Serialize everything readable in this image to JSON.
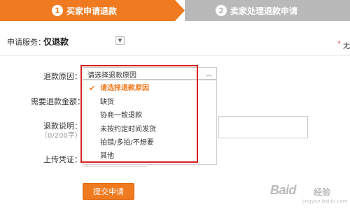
{
  "steps": [
    {
      "number": "1",
      "label": "买家申请退款",
      "active": true
    },
    {
      "number": "2",
      "label": "卖家处理退款申请",
      "active": false
    }
  ],
  "service": {
    "label": "申请服务：",
    "value": "仅退款",
    "toggle_icon": "chevron-down-icon"
  },
  "side_note": {
    "star": "*",
    "text": "尢"
  },
  "form": {
    "reason_label": "退款原因：",
    "amount_label": "需要退款金额：",
    "required_mark": "*",
    "desc_label": "退款说明：",
    "desc_count": "（0/200字）",
    "proof_label": "上传凭证："
  },
  "reason_select": {
    "value": "请选择退款原因",
    "caret_icon": "chevron-up-icon",
    "options": [
      {
        "label": "请选择退款原因",
        "selected": true
      },
      {
        "label": "缺货",
        "selected": false
      },
      {
        "label": "协商一致退款",
        "selected": false
      },
      {
        "label": "未按约定时间发货",
        "selected": false
      },
      {
        "label": "拍错/多拍/不想要",
        "selected": false
      },
      {
        "label": "其他",
        "selected": false
      }
    ]
  },
  "submit": {
    "label": "提交申请"
  },
  "watermark": {
    "brand": "Baid",
    "cn": "经验",
    "sub": "jingyan.baidu.com"
  },
  "colors": {
    "accent": "#f07a1f",
    "inactive_step": "#b9b9b9",
    "highlight": "#d92020",
    "required": "#e33333"
  }
}
